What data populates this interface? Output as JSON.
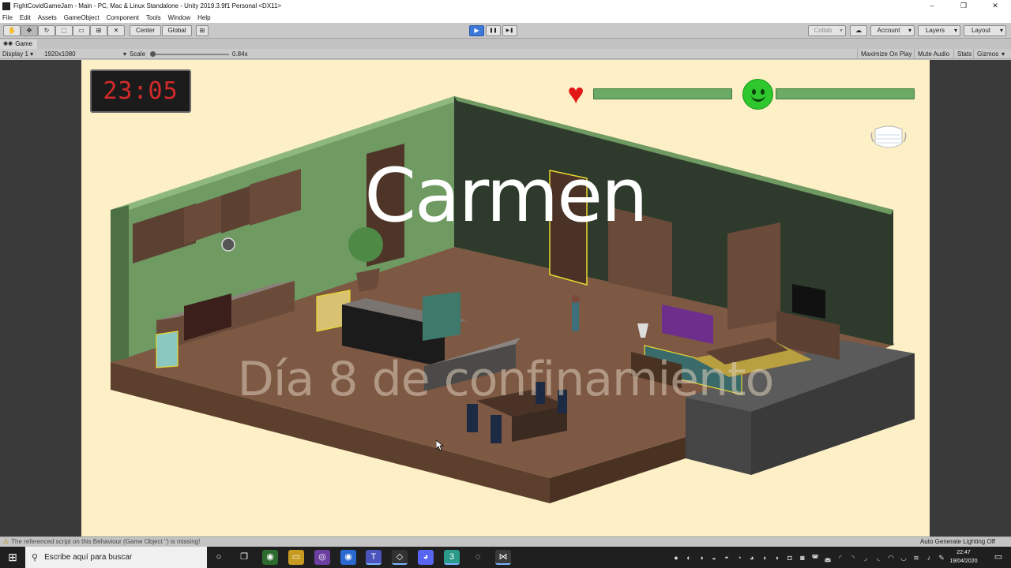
{
  "window": {
    "title": "FightCovidGameJam - Main - PC, Mac & Linux Standalone - Unity 2019.3.9f1 Personal <DX11>",
    "minimize": "–",
    "maximize": "❐",
    "close": "✕"
  },
  "menu": [
    "File",
    "Edit",
    "Assets",
    "GameObject",
    "Component",
    "Tools",
    "Window",
    "Help"
  ],
  "toolbar": {
    "tools": [
      {
        "name": "hand-tool-icon",
        "glyph": "✋"
      },
      {
        "name": "move-tool-icon",
        "glyph": "✥"
      },
      {
        "name": "rotate-tool-icon",
        "glyph": "↻"
      },
      {
        "name": "scale-tool-icon",
        "glyph": "⬚"
      },
      {
        "name": "rect-tool-icon",
        "glyph": "▭"
      },
      {
        "name": "transform-tool-icon",
        "glyph": "⊞"
      },
      {
        "name": "custom-tool-icon",
        "glyph": "✕"
      }
    ],
    "pivot": "Center",
    "space": "Global",
    "snap_icon": "⊞",
    "play": "▶",
    "pause": "❚❚",
    "step": "▶❚",
    "collab": "Collab",
    "cloud": "☁",
    "account": "Account",
    "layers": "Layers",
    "layout": "Layout"
  },
  "tab": {
    "label": "Game",
    "icon": "◉◉"
  },
  "gamebar": {
    "display": "Display 1",
    "resolution": "1920x1080",
    "scale_label": "Scale",
    "scale_value": "0.84x",
    "maximize": "Maximize On Play",
    "mute": "Mute Audio",
    "stats": "Stats",
    "gizmos": "Gizmos"
  },
  "game": {
    "clock": "23:05",
    "health_fill": 1.0,
    "mood_fill": 1.0,
    "character_name": "Carmen",
    "day_text": "Día 8 de confinamiento"
  },
  "status": {
    "message": "The referenced script on this Behaviour (Game Object '') is missing!",
    "lighting": "Auto Generate Lighting Off"
  },
  "taskbar": {
    "search_placeholder": "Escribe aquí para buscar",
    "time": "22:47",
    "date": "19/04/2020"
  },
  "colors": {
    "accent": "#3c78d8",
    "game_bg": "#fdefc6",
    "wall": "#5a8a55",
    "floor": "#7a5844",
    "health": "#6cab66",
    "heart": "#e21818",
    "smiley": "#2ec82e"
  }
}
